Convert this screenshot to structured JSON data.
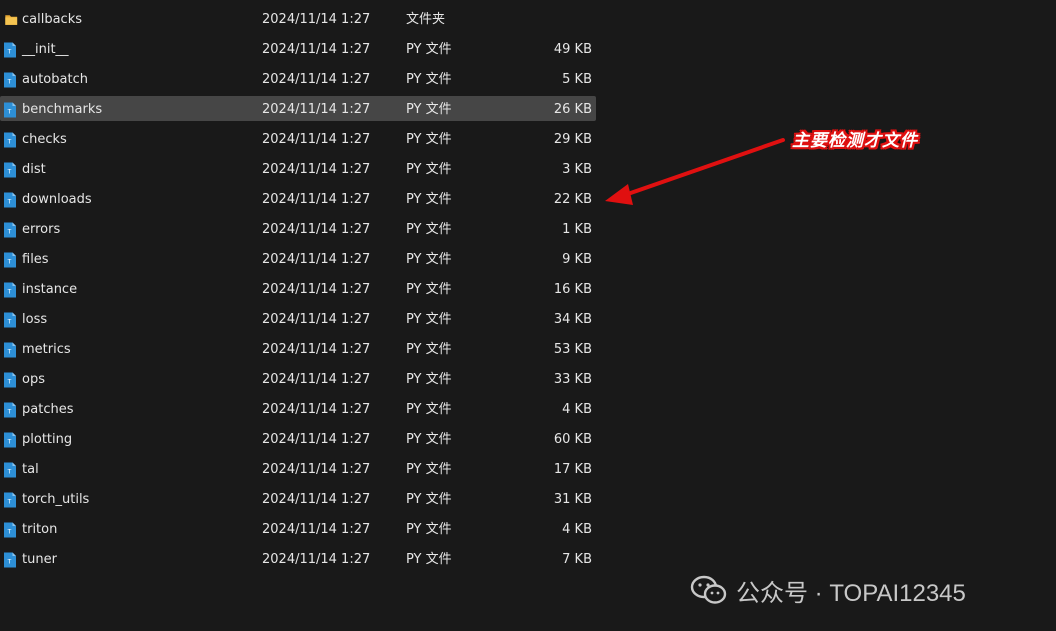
{
  "files": [
    {
      "name": "callbacks",
      "date": "2024/11/14 1:27",
      "type": "文件夹",
      "size": "",
      "icon": "folder-icon",
      "selected": false
    },
    {
      "name": "__init__",
      "date": "2024/11/14 1:27",
      "type": "PY 文件",
      "size": "49 KB",
      "icon": "python-file-icon",
      "selected": false
    },
    {
      "name": "autobatch",
      "date": "2024/11/14 1:27",
      "type": "PY 文件",
      "size": "5 KB",
      "icon": "python-file-icon",
      "selected": false
    },
    {
      "name": "benchmarks",
      "date": "2024/11/14 1:27",
      "type": "PY 文件",
      "size": "26 KB",
      "icon": "python-file-icon",
      "selected": true
    },
    {
      "name": "checks",
      "date": "2024/11/14 1:27",
      "type": "PY 文件",
      "size": "29 KB",
      "icon": "python-file-icon",
      "selected": false
    },
    {
      "name": "dist",
      "date": "2024/11/14 1:27",
      "type": "PY 文件",
      "size": "3 KB",
      "icon": "python-file-icon",
      "selected": false
    },
    {
      "name": "downloads",
      "date": "2024/11/14 1:27",
      "type": "PY 文件",
      "size": "22 KB",
      "icon": "python-file-icon",
      "selected": false
    },
    {
      "name": "errors",
      "date": "2024/11/14 1:27",
      "type": "PY 文件",
      "size": "1 KB",
      "icon": "python-file-icon",
      "selected": false
    },
    {
      "name": "files",
      "date": "2024/11/14 1:27",
      "type": "PY 文件",
      "size": "9 KB",
      "icon": "python-file-icon",
      "selected": false
    },
    {
      "name": "instance",
      "date": "2024/11/14 1:27",
      "type": "PY 文件",
      "size": "16 KB",
      "icon": "python-file-icon",
      "selected": false
    },
    {
      "name": "loss",
      "date": "2024/11/14 1:27",
      "type": "PY 文件",
      "size": "34 KB",
      "icon": "python-file-icon",
      "selected": false
    },
    {
      "name": "metrics",
      "date": "2024/11/14 1:27",
      "type": "PY 文件",
      "size": "53 KB",
      "icon": "python-file-icon",
      "selected": false
    },
    {
      "name": "ops",
      "date": "2024/11/14 1:27",
      "type": "PY 文件",
      "size": "33 KB",
      "icon": "python-file-icon",
      "selected": false
    },
    {
      "name": "patches",
      "date": "2024/11/14 1:27",
      "type": "PY 文件",
      "size": "4 KB",
      "icon": "python-file-icon",
      "selected": false
    },
    {
      "name": "plotting",
      "date": "2024/11/14 1:27",
      "type": "PY 文件",
      "size": "60 KB",
      "icon": "python-file-icon",
      "selected": false
    },
    {
      "name": "tal",
      "date": "2024/11/14 1:27",
      "type": "PY 文件",
      "size": "17 KB",
      "icon": "python-file-icon",
      "selected": false
    },
    {
      "name": "torch_utils",
      "date": "2024/11/14 1:27",
      "type": "PY 文件",
      "size": "31 KB",
      "icon": "python-file-icon",
      "selected": false
    },
    {
      "name": "triton",
      "date": "2024/11/14 1:27",
      "type": "PY 文件",
      "size": "4 KB",
      "icon": "python-file-icon",
      "selected": false
    },
    {
      "name": "tuner",
      "date": "2024/11/14 1:27",
      "type": "PY 文件",
      "size": "7 KB",
      "icon": "python-file-icon",
      "selected": false
    }
  ],
  "annotation": {
    "text": "主要检测才文件",
    "color": "#e01010",
    "icon": "red-arrow-icon"
  },
  "watermark": {
    "text": "公众号 · TOPAI12345",
    "icon": "wechat-logo-icon"
  },
  "colors": {
    "background": "#191919",
    "selected_row": "#464646",
    "text": "#e6e6e6",
    "folder": "#f2c14e",
    "py_icon": "#2d8fd6"
  }
}
